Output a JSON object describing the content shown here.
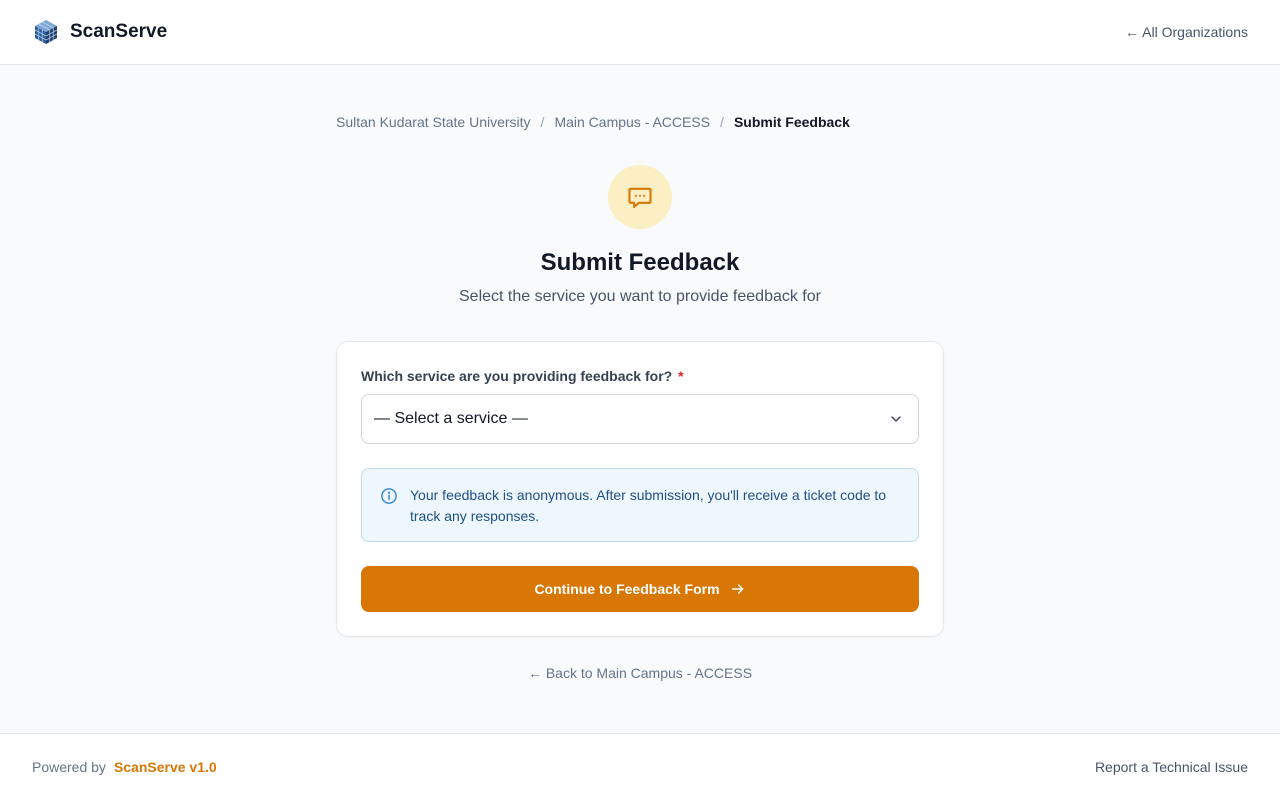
{
  "header": {
    "brand_name": "ScanServe",
    "all_orgs_link": "← All Organizations"
  },
  "breadcrumb": {
    "items": [
      "Sultan Kudarat State University",
      "Main Campus - ACCESS",
      "Submit Feedback"
    ],
    "separator": "/"
  },
  "hero": {
    "icon": "chat-bubble-icon",
    "title": "Submit Feedback",
    "subtitle": "Select the service you want to provide feedback for"
  },
  "form": {
    "label": "Which service are you providing feedback for?",
    "required_mark": "*",
    "select_value": "— Select a service —",
    "info_text": "Your feedback is anonymous. After submission, you'll receive a ticket code to track any responses.",
    "submit_label": "Continue to Feedback Form"
  },
  "back_link": "← Back to Main Campus - ACCESS",
  "footer": {
    "powered_by": "Powered by",
    "brand_version": "ScanServe v1.0",
    "report_link": "Report a Technical Issue"
  },
  "colors": {
    "accent": "#d97706",
    "hero_icon_bg": "#fdefc4",
    "info_bg": "#eef6fe",
    "info_text": "#1e4f8a"
  }
}
